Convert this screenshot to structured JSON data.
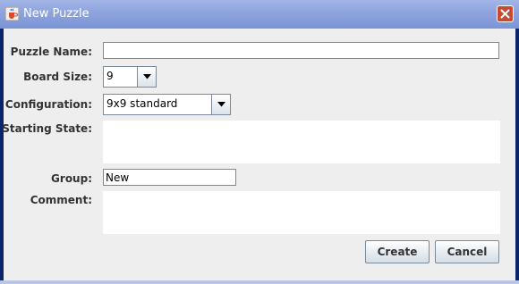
{
  "window": {
    "title": "New Puzzle",
    "title_icon": "java-cup-icon",
    "close_icon": "close-icon"
  },
  "form": {
    "puzzle_name": {
      "label": "Puzzle Name:",
      "value": ""
    },
    "board_size": {
      "label": "Board Size:",
      "value": "9"
    },
    "configuration": {
      "label": "Configuration:",
      "value": "9x9 standard"
    },
    "starting_state": {
      "label": "Starting State:",
      "value": ""
    },
    "group": {
      "label": "Group:",
      "value": "New"
    },
    "comment": {
      "label": "Comment:",
      "value": ""
    }
  },
  "buttons": {
    "create": "Create",
    "cancel": "Cancel"
  },
  "colors": {
    "titlebar": "#8fa5de",
    "client_background": "#eeeeee",
    "close_button": "#c84a30"
  }
}
